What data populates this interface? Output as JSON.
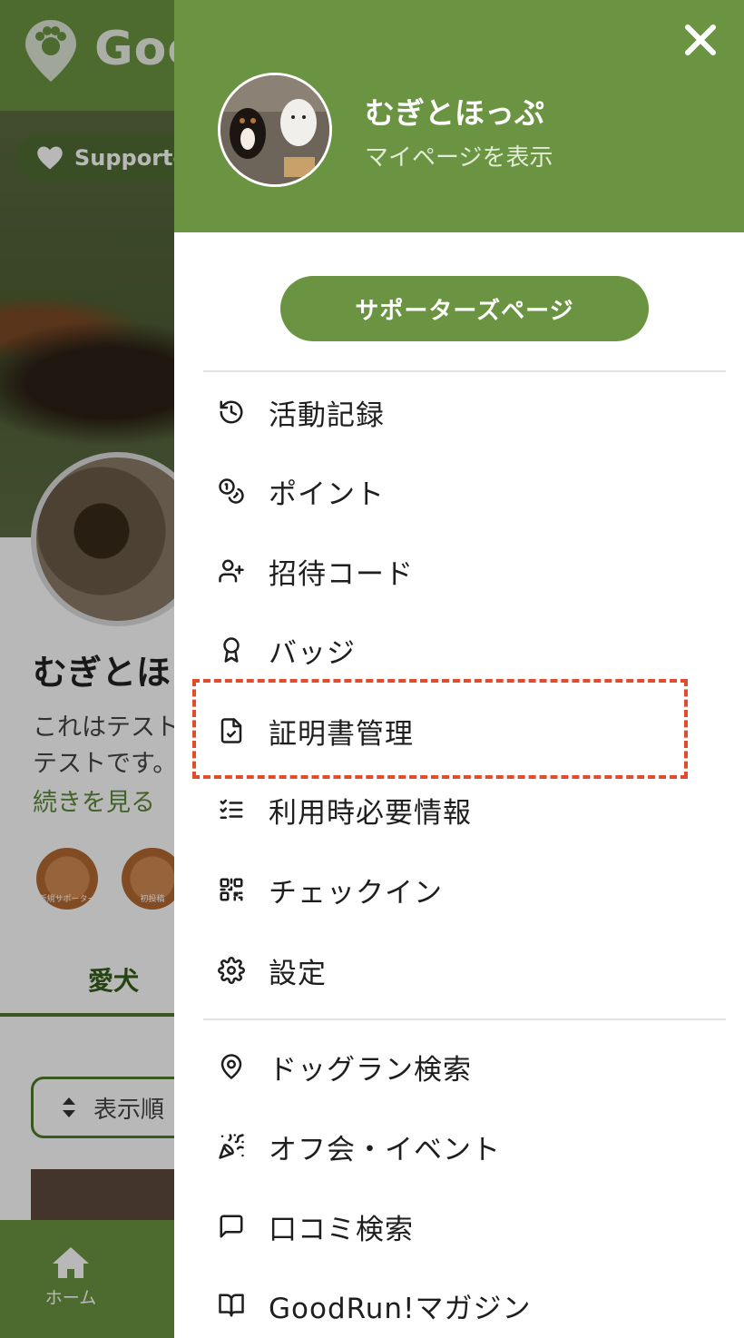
{
  "background": {
    "logo_text": "Goo",
    "supporter_pill": "Supporte",
    "profile_name": "むぎとほ",
    "profile_desc_line1": "これはテスト",
    "profile_desc_line2": "テストです。",
    "read_more": "続きを見る",
    "badges": [
      "新規サポーター",
      "初投稿"
    ],
    "tab_label": "愛犬",
    "sort_label": "表示順",
    "bottom_nav_home": "ホーム"
  },
  "drawer": {
    "user_name": "むぎとほっぷ",
    "user_link": "マイページを表示",
    "supporters_button": "サポーターズページ",
    "menu_group1": [
      {
        "label": "活動記録",
        "icon": "history-icon"
      },
      {
        "label": "ポイント",
        "icon": "coins-icon"
      },
      {
        "label": "招待コード",
        "icon": "user-plus-icon"
      },
      {
        "label": "バッジ",
        "icon": "award-icon"
      },
      {
        "label": "証明書管理",
        "icon": "file-check-icon"
      },
      {
        "label": "利用時必要情報",
        "icon": "list-check-icon"
      },
      {
        "label": "チェックイン",
        "icon": "qrcode-icon"
      },
      {
        "label": "設定",
        "icon": "gear-icon"
      }
    ],
    "menu_group2": [
      {
        "label": "ドッグラン検索",
        "icon": "map-pin-icon"
      },
      {
        "label": "オフ会・イベント",
        "icon": "party-popper-icon"
      },
      {
        "label": "口コミ検索",
        "icon": "message-square-icon"
      },
      {
        "label": "GoodRun!マガジン",
        "icon": "book-open-icon"
      }
    ],
    "highlighted_item": "証明書管理"
  },
  "colors": {
    "brand_green": "#6b9442",
    "highlight_red": "#e04c2c"
  }
}
